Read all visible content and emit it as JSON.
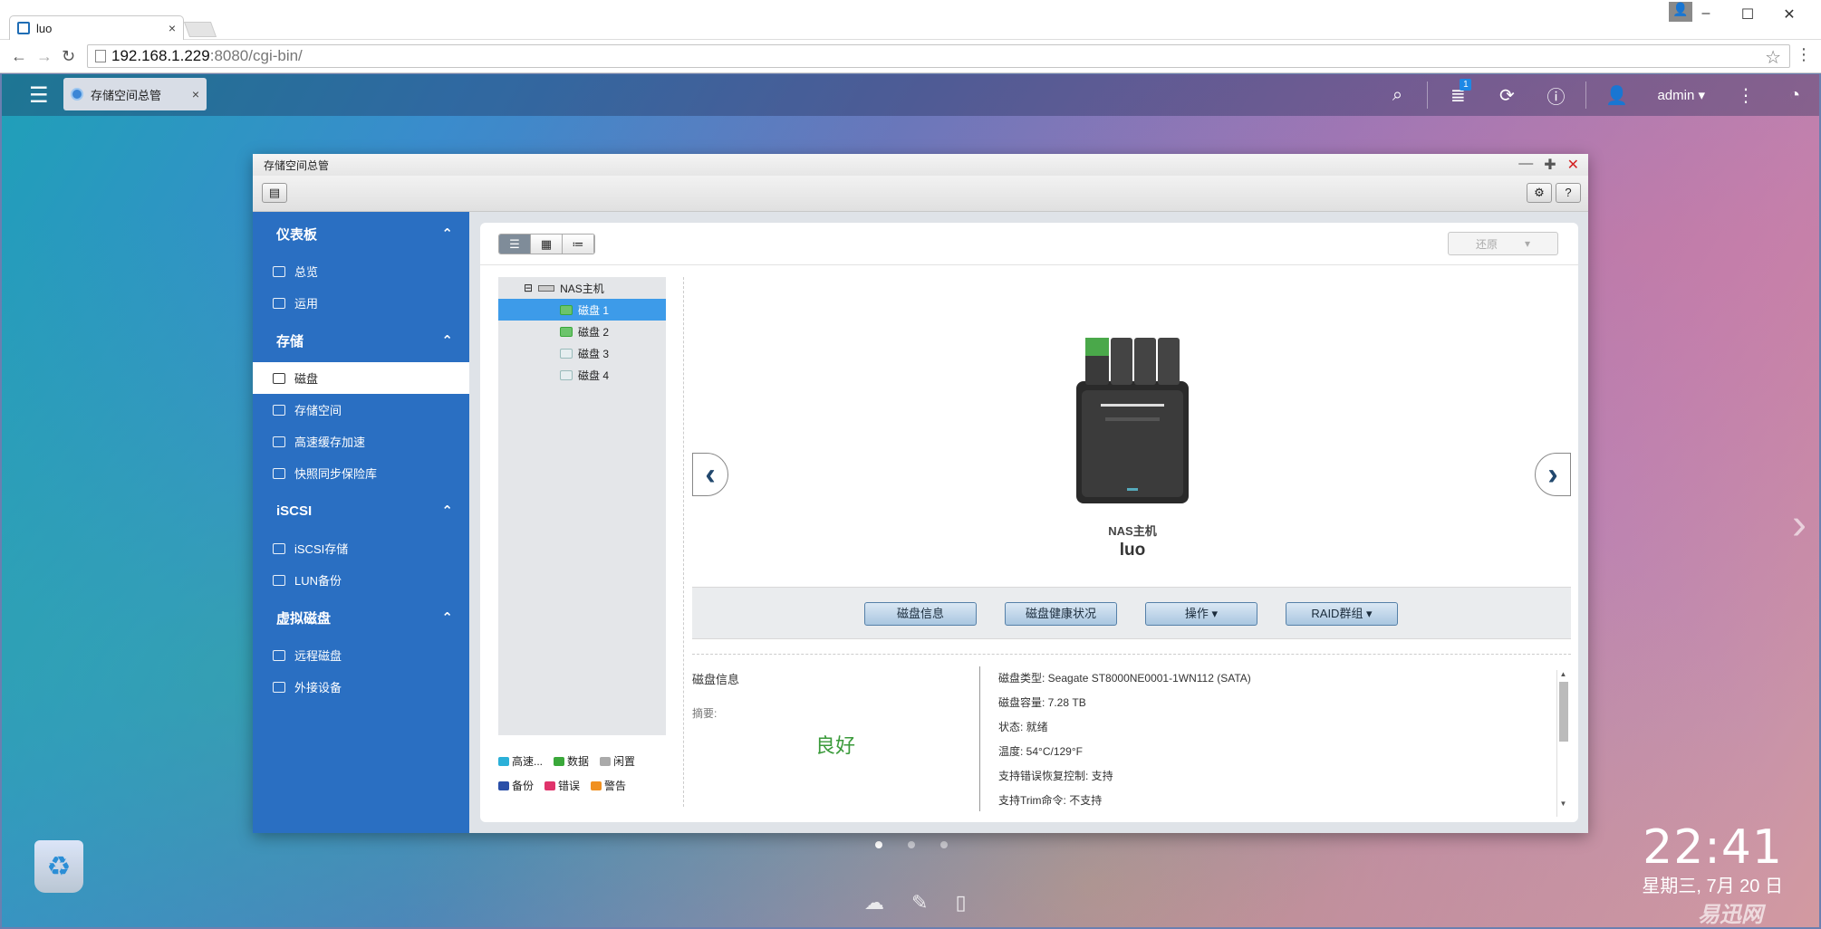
{
  "browser": {
    "tab_title": "luo",
    "tab_close": "×",
    "url_host": "192.168.1.229",
    "url_path": ":8080/cgi-bin/",
    "back": "←",
    "forward": "→",
    "reload": "↻",
    "star": "☆",
    "menu": "⋮",
    "win_min": "–",
    "win_max": "☐",
    "win_close": "✕",
    "user_icon": "👤"
  },
  "qts": {
    "menu": "☰",
    "app_tab": "存储空间总管",
    "app_tab_close": "×",
    "user": "admin ▾",
    "notif_count": "1",
    "search": "⌕",
    "tasks": "≣",
    "sync": "⟳",
    "info": "ⓘ",
    "account": "👤",
    "more": "⋮",
    "dashboard": "◔"
  },
  "window": {
    "title": "存储空间总管",
    "minimize": "—",
    "maximize": "✚",
    "close": "✕",
    "tool_left": "▤",
    "tool_gear": "⚙",
    "tool_help": "?"
  },
  "sidebar": {
    "sec_dashboard": "仪表板",
    "overview": "总览",
    "usage": "运用",
    "sec_storage": "存储",
    "disks": "磁盘",
    "storage_space": "存储空间",
    "cache": "高速缓存加速",
    "snapshot": "快照同步保险库",
    "sec_iscsi": "iSCSI",
    "iscsi_storage": "iSCSI存储",
    "lun_backup": "LUN备份",
    "sec_virtual": "虚拟磁盘",
    "remote_disk": "远程磁盘",
    "external": "外接设备",
    "chev": "⌃"
  },
  "view": {
    "v1": "☰",
    "v2": "▦",
    "v3": "≔",
    "restore": "还原",
    "restore_arrow": "▾"
  },
  "tree": {
    "root": "NAS主机",
    "root_toggle": "⊟",
    "disk1": "磁盘 1",
    "disk2": "磁盘 2",
    "disk3": "磁盘 3",
    "disk4": "磁盘 4"
  },
  "legend": {
    "cache": "高速...",
    "data": "数据",
    "idle": "闲置",
    "backup": "备份",
    "error": "错误",
    "warning": "警告"
  },
  "device": {
    "label": "NAS主机",
    "name": "luo",
    "prev": "‹",
    "next": "›"
  },
  "actions": {
    "disk_info": "磁盘信息",
    "health": "磁盘健康状况",
    "operate": "操作 ▾",
    "raid": "RAID群组 ▾"
  },
  "info": {
    "heading": "磁盘信息",
    "summary_label": "摘要:",
    "summary_value": "良好",
    "type": "磁盘类型:  Seagate ST8000NE0001-1WN112 (SATA)",
    "capacity": "磁盘容量:  7.28 TB",
    "status": "状态:  就绪",
    "temp": "温度:  54°C/129°F",
    "erc": "支持错误恢复控制:  支持",
    "trim": "支持Trim命令:  不支持",
    "sb_up": "▲",
    "sb_dn": "▼"
  },
  "desktop": {
    "time": "22:41",
    "date": "星期三, 7月 20 日",
    "recycle": "♻",
    "watermark": "易迅网",
    "side_arrow": "›",
    "dock1": "☁",
    "dock2": "✎",
    "dock3": "▯"
  },
  "colors": {
    "sidebar": "#2a6fc2",
    "selected": "#3d9be9",
    "good": "#3a9a3a",
    "close": "#d32323"
  }
}
